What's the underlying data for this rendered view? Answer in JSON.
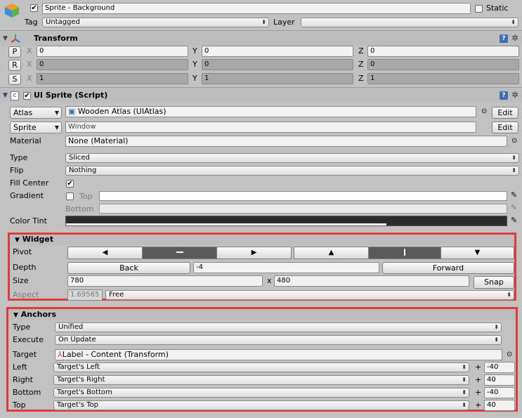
{
  "header": {
    "object_name": "Sprite - Background",
    "static_label": "Static",
    "tag_label": "Tag",
    "tag_value": "Untagged",
    "layer_label": "Layer",
    "layer_value": ""
  },
  "transform": {
    "title": "Transform",
    "rows": [
      {
        "btn": "P",
        "x": "0",
        "y": "0",
        "z": "0"
      },
      {
        "btn": "R",
        "x": "0",
        "y": "0",
        "z": "0"
      },
      {
        "btn": "S",
        "x": "1",
        "y": "1",
        "z": "1"
      }
    ],
    "x_label": "X",
    "y_label": "Y",
    "z_label": "Z"
  },
  "ui_sprite": {
    "title": "UI Sprite (Script)",
    "atlas_btn": "Atlas",
    "atlas_value": "Wooden Atlas (UIAtlas)",
    "sprite_btn": "Sprite",
    "sprite_value": "Window",
    "edit_label": "Edit",
    "material_label": "Material",
    "material_value": "None (Material)",
    "type_label": "Type",
    "type_value": "Sliced",
    "flip_label": "Flip",
    "flip_value": "Nothing",
    "fill_center_label": "Fill Center",
    "gradient_label": "Gradient",
    "top_label": "Top",
    "bottom_label": "Bottom",
    "color_tint_label": "Color Tint"
  },
  "widget": {
    "title": "Widget",
    "pivot_label": "Pivot",
    "depth_label": "Depth",
    "back_btn": "Back",
    "depth_value": "-4",
    "forward_btn": "Forward",
    "size_label": "Size",
    "width_value": "780",
    "x_sep": "x",
    "height_value": "480",
    "snap_btn": "Snap",
    "aspect_label": "Aspect",
    "aspect_value": "1.69565",
    "aspect_mode": "Free"
  },
  "anchors": {
    "title": "Anchors",
    "type_label": "Type",
    "type_value": "Unified",
    "execute_label": "Execute",
    "execute_value": "On Update",
    "target_label": "Target",
    "target_value": "Label - Content (Transform)",
    "plus": "+",
    "sides": [
      {
        "label": "Left",
        "value": "Target's Left",
        "offset": "-40"
      },
      {
        "label": "Right",
        "value": "Target's Right",
        "offset": "40"
      },
      {
        "label": "Bottom",
        "value": "Target's Bottom",
        "offset": "-40"
      },
      {
        "label": "Top",
        "value": "Target's Top",
        "offset": "40"
      }
    ]
  },
  "icons": {
    "checked": "✔",
    "dropdown": "⬍",
    "left": "◀",
    "right": "▶",
    "up": "▲",
    "down": "▼",
    "collapse": "▼",
    "gear": "✲",
    "help": "?",
    "picker": "⊙"
  }
}
